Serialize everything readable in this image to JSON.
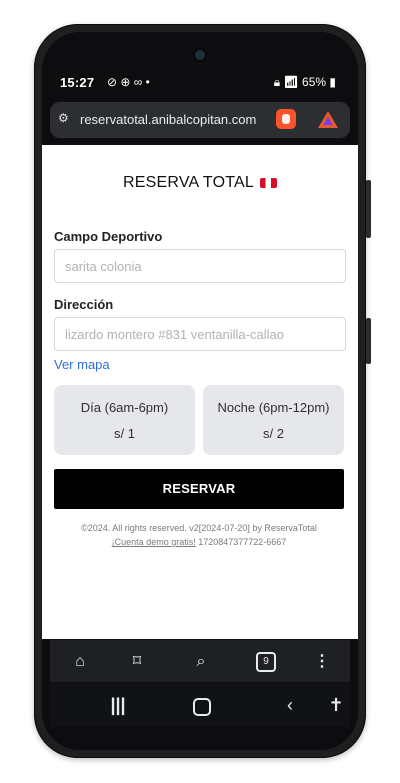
{
  "status_bar": {
    "time": "15:27",
    "left_icons": "⊘ ⊕ ∞ •",
    "battery_percent": "65%"
  },
  "browser": {
    "url": "reservatotal.anibalcopitan.com",
    "tab_count": "9"
  },
  "page": {
    "title": "RESERVA TOTAL",
    "campo_label": "Campo Deportivo",
    "campo_placeholder": "sarita colonia",
    "direccion_label": "Dirección",
    "direccion_placeholder": "lizardo montero #831 ventanilla-callao",
    "map_link": "Ver mapa",
    "options": [
      {
        "line1": "Día (6am-6pm)",
        "line2": "s/ 1"
      },
      {
        "line1": "Noche (6pm-12pm)",
        "line2": "s/ 2"
      }
    ],
    "reserve_button": "RESERVAR",
    "footer_line1": "©2024. All rights reserved. v2[2024-07-20] by ReservaTotal",
    "footer_link": "¡Cuenta demo gratis!",
    "footer_phone": " 1720847377722-6667"
  },
  "colors": {
    "accent_link": "#2f6fd6",
    "button_bg": "#000000",
    "option_bg": "#e5e7eb",
    "brave": "#fb542b"
  }
}
